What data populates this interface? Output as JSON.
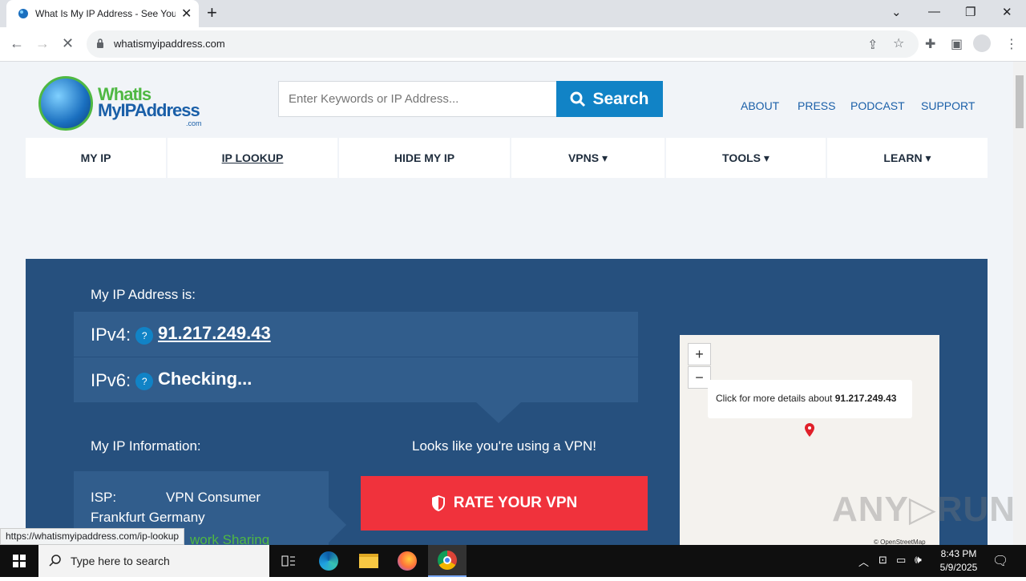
{
  "browser": {
    "tab_title": "What Is My IP Address - See You",
    "url": "whatismyipaddress.com",
    "status_url": "https://whatismyipaddress.com/ip-lookup"
  },
  "site": {
    "logo": {
      "line1": "WhatIs",
      "line2": "MyIPAddress",
      "line3": ".com"
    },
    "search": {
      "placeholder": "Enter Keywords or IP Address...",
      "button": "Search"
    },
    "top_links": [
      "ABOUT",
      "PRESS",
      "PODCAST",
      "SUPPORT"
    ],
    "nav": [
      {
        "label": "MY IP"
      },
      {
        "label": "IP LOOKUP"
      },
      {
        "label": "HIDE MY IP"
      },
      {
        "label": "VPNS ▾"
      },
      {
        "label": "TOOLS ▾"
      },
      {
        "label": "LEARN ▾"
      }
    ]
  },
  "hero": {
    "heading": "My IP Address is:",
    "ipv4_label": "IPv4:",
    "ipv4_value": "91.217.249.43",
    "ipv6_label": "IPv6:",
    "ipv6_value": "Checking...",
    "help": "?",
    "info_heading": "My IP Information:",
    "vpn_notice": "Looks like you're using a VPN!",
    "rate_button": "RATE YOUR VPN",
    "isp_label": "ISP:",
    "isp_value": "VPN Consumer",
    "location": "Frankfurt Germany",
    "partial": "work Sharing"
  },
  "map": {
    "zoom_in": "+",
    "zoom_out": "−",
    "popup_text": "Click for more details about ",
    "popup_ip": "91.217.249.43",
    "attribution": "© OpenStreetMap"
  },
  "watermark": "ANY▷RUN",
  "taskbar": {
    "search_placeholder": "Type here to search",
    "time": "8:43 PM",
    "date": "5/9/2025"
  },
  "colors": {
    "hero_bg": "#26507e",
    "accent_blue": "#1183c6",
    "rate_red": "#f0323c"
  }
}
